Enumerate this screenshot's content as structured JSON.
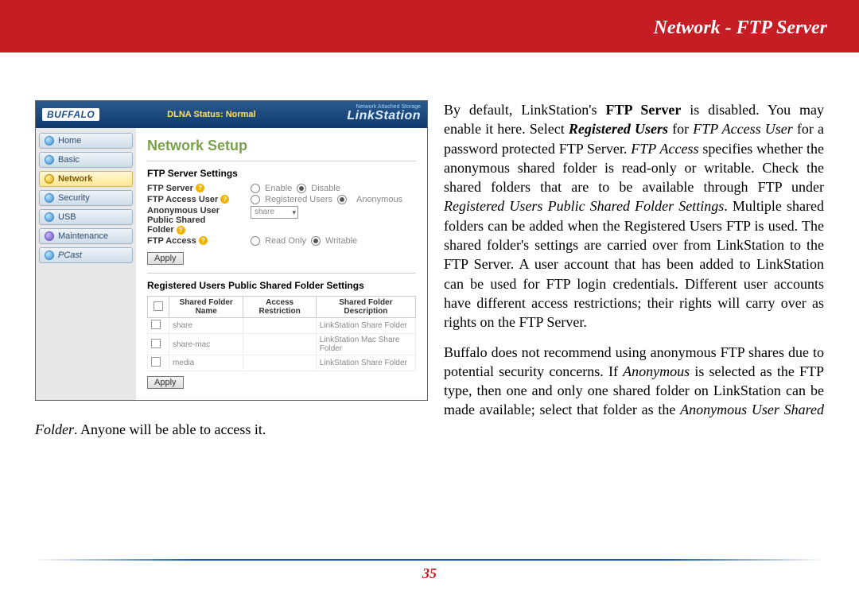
{
  "header": {
    "title": "Network - FTP Server"
  },
  "page_number": "35",
  "screenshot": {
    "brand": "BUFFALO",
    "dlna": "DLNA Status: Normal",
    "product_small": "Network Attached Storage",
    "product_big": "LinkStation",
    "sidebar": [
      {
        "label": "Home"
      },
      {
        "label": "Basic"
      },
      {
        "label": "Network"
      },
      {
        "label": "Security"
      },
      {
        "label": "USB"
      },
      {
        "label": "Maintenance"
      },
      {
        "label": "PCast"
      }
    ],
    "h1": "Network Setup",
    "section1_title": "FTP Server Settings",
    "rows": {
      "ftp_server_label": "FTP Server",
      "ftp_server_opts": [
        "Enable",
        "Disable"
      ],
      "ftp_access_user_label": "FTP Access User",
      "ftp_access_user_opts": [
        "Registered Users",
        "Anonymous"
      ],
      "anon_label_l1": "Anonymous User",
      "anon_label_l2": "Public Shared",
      "anon_label_l3": "Folder",
      "anon_select": "share",
      "ftp_access_label": "FTP Access",
      "ftp_access_opts": [
        "Read Only",
        "Writable"
      ]
    },
    "apply": "Apply",
    "section2_title": "Registered Users Public Shared Folder Settings",
    "table_headers": [
      "",
      "Shared Folder Name",
      "Access Restriction",
      "Shared Folder Description"
    ],
    "table_rows": [
      {
        "name": "share",
        "restriction": "",
        "desc": "LinkStation Share Folder"
      },
      {
        "name": "share-mac",
        "restriction": "",
        "desc": "LinkStation Mac Share Folder"
      },
      {
        "name": "media",
        "restriction": "",
        "desc": "LinkStation Share Folder"
      }
    ]
  },
  "body": {
    "p1_a": "By default, LinkStation's ",
    "p1_b": "FTP Server",
    "p1_c": " is disabled.  You may enable it here.  Select ",
    "p1_d": "Registered Users",
    "p1_e": " for ",
    "p1_f": "FTP Access User",
    "p1_g": " for a password protected FTP Server.  ",
    "p1_h": "FTP Access",
    "p1_i": " specifies whether the anonymous shared folder is read-only or writable.  Check the shared folders that are to be available through FTP under ",
    "p1_j": "Registered Users Public Shared Folder Settings",
    "p1_k": ".  Multiple shared folders can be added when the Registered Users FTP is used.  The shared folder's settings are carried over from LinkStation to the FTP Server.  A user account that has been added to LinkStation can be used for FTP login credentials.  Different user accounts have different access restrictions; their rights will carry over as rights on the FTP Server.",
    "p2_a": "Buffalo does not recommend using anonymous FTP shares due to potential security concerns.  If ",
    "p2_b": "Anonymous",
    "p2_c": " is selected as the FTP type, then one and only one shared folder on LinkStation can be made available; select that folder as the ",
    "p2_d": "Anonymous User Shared Folder",
    "p2_e": ".  Anyone will be able to access it."
  }
}
